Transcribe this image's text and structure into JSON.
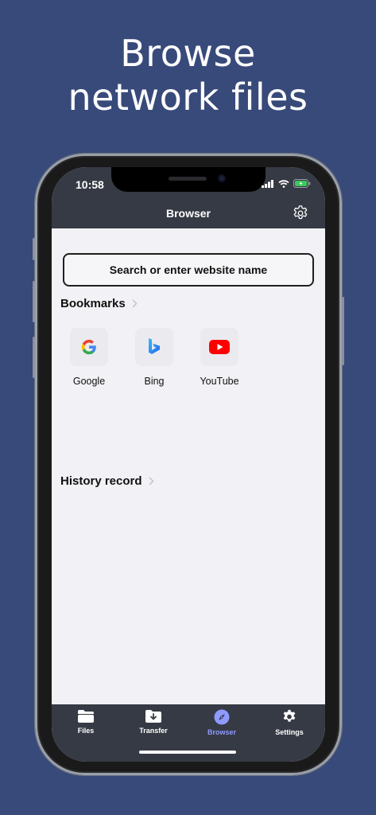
{
  "headline": {
    "line1": "Browse",
    "line2": "network files"
  },
  "status_bar": {
    "time": "10:58"
  },
  "nav": {
    "title": "Browser"
  },
  "search": {
    "placeholder": "Search or enter website name"
  },
  "bookmarks": {
    "title": "Bookmarks",
    "items": [
      {
        "label": "Google",
        "icon": "google-icon"
      },
      {
        "label": "Bing",
        "icon": "bing-icon"
      },
      {
        "label": "YouTube",
        "icon": "youtube-icon"
      }
    ]
  },
  "history": {
    "title": "History record"
  },
  "tabs": [
    {
      "label": "Files",
      "icon": "folder-icon",
      "active": false
    },
    {
      "label": "Transfer",
      "icon": "download-folder-icon",
      "active": false
    },
    {
      "label": "Browser",
      "icon": "compass-icon",
      "active": true
    },
    {
      "label": "Settings",
      "icon": "gear-icon",
      "active": false
    }
  ],
  "colors": {
    "background": "#384a7a",
    "bar": "#363a44",
    "accent": "#8f9aff",
    "content": "#f2f1f5"
  }
}
